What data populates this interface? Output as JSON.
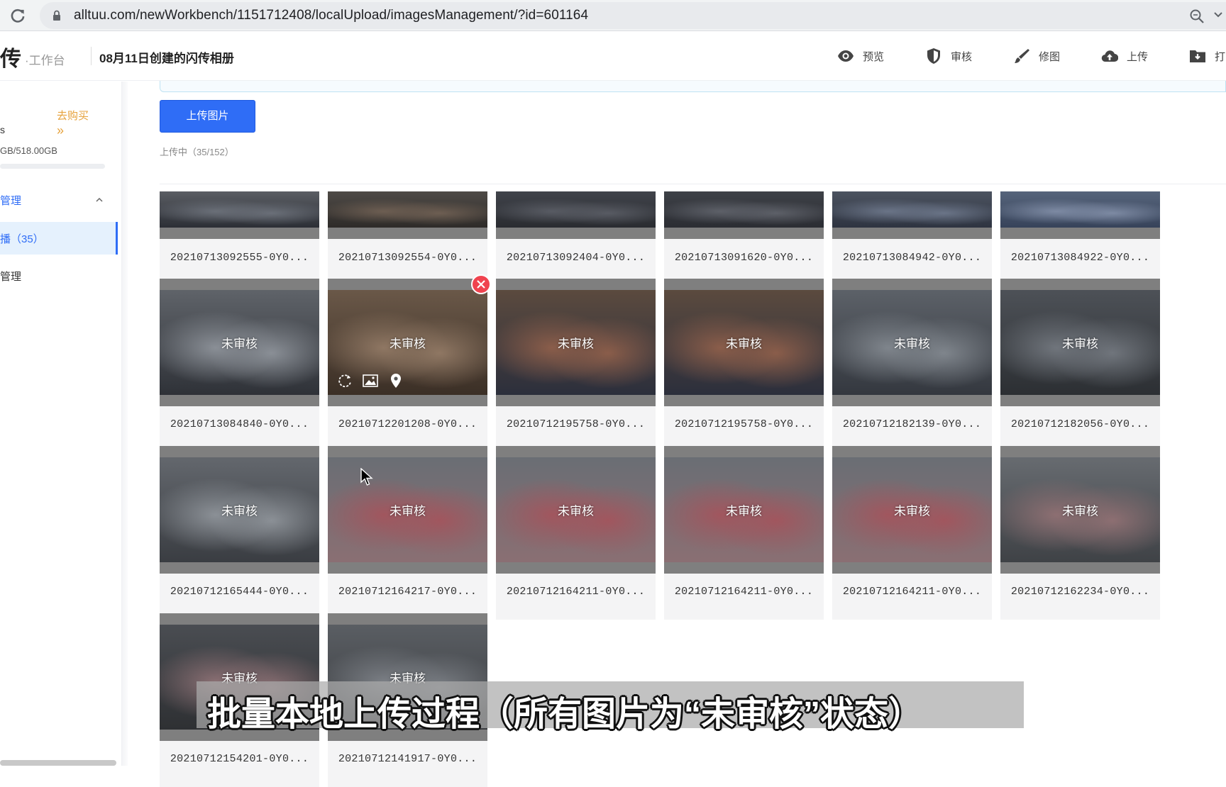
{
  "browser": {
    "url": "alltuu.com/newWorkbench/1151712408/localUpload/imagesManagement/?id=601164"
  },
  "header": {
    "logo": "传",
    "logo_sub": "·工作台",
    "album_title": "08月11日创建的闪传相册",
    "actions": [
      {
        "label": "预览",
        "icon": "eye-icon"
      },
      {
        "label": "审核",
        "icon": "shield-icon"
      },
      {
        "label": "修图",
        "icon": "brush-icon"
      },
      {
        "label": "上传",
        "icon": "cloud-upload-icon"
      },
      {
        "label": "打",
        "icon": "folder-download-icon"
      }
    ]
  },
  "sidebar": {
    "stub": "s",
    "buy_label": "去购买",
    "buy_arrows": "»",
    "storage": "GB/518.00GB",
    "menu_head": "管理",
    "active_item": "播（35）",
    "item2": "管理"
  },
  "main": {
    "upload_button": "上传图片",
    "progress": "上传中（35/152）",
    "subtitle": "批量本地上传过程（所有图片为“未审核”状态）"
  },
  "images": [
    {
      "name": "20210713092555-0Y0...",
      "status": ""
    },
    {
      "name": "20210713092554-0Y0...",
      "status": ""
    },
    {
      "name": "20210713092404-0Y0...",
      "status": ""
    },
    {
      "name": "20210713091620-0Y0...",
      "status": ""
    },
    {
      "name": "20210713084942-0Y0...",
      "status": ""
    },
    {
      "name": "20210713084922-0Y0...",
      "status": ""
    },
    {
      "name": "20210713084840-0Y0...",
      "status": "未审核"
    },
    {
      "name": "20210712201208-0Y0...",
      "status": "未审核"
    },
    {
      "name": "20210712195758-0Y0...",
      "status": "未审核"
    },
    {
      "name": "20210712195758-0Y0...",
      "status": "未审核"
    },
    {
      "name": "20210712182139-0Y0...",
      "status": "未审核"
    },
    {
      "name": "20210712182056-0Y0...",
      "status": "未审核"
    },
    {
      "name": "20210712165444-0Y0...",
      "status": "未审核"
    },
    {
      "name": "20210712164217-0Y0...",
      "status": "未审核"
    },
    {
      "name": "20210712164211-0Y0...",
      "status": "未审核"
    },
    {
      "name": "20210712164211-0Y0...",
      "status": "未审核"
    },
    {
      "name": "20210712164211-0Y0...",
      "status": "未审核"
    },
    {
      "name": "20210712162234-0Y0...",
      "status": "未审核"
    },
    {
      "name": "20210712154201-0Y0...",
      "status": "未审核"
    },
    {
      "name": "20210712141917-0Y0...",
      "status": "未审核"
    }
  ],
  "colors": {
    "accent": "#2f6df6",
    "delete": "#f0434f",
    "buy": "#e6a23c",
    "active_bg": "#e5f1fd"
  }
}
